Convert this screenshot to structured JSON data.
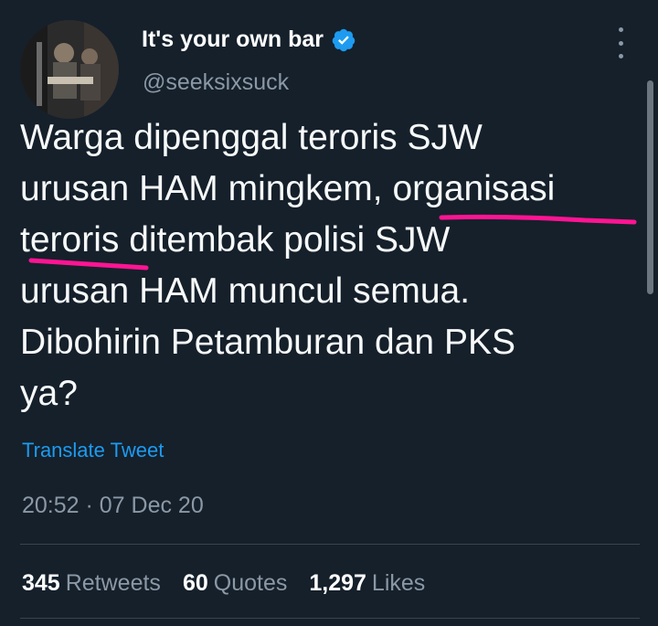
{
  "author": {
    "display_name": "It's your own bar",
    "handle": "@seeksixsuck"
  },
  "tweet": {
    "lines": [
      "Warga dipenggal teroris SJW",
      "urusan HAM mingkem, organisasi",
      "teroris ditembak polisi SJW",
      "urusan HAM muncul semua.",
      "Dibohirin Petamburan dan PKS",
      "ya?"
    ],
    "translate_label": "Translate Tweet",
    "timestamp": "20:52 · 07 Dec 20"
  },
  "stats": {
    "retweets_count": "345",
    "retweets_label": "Retweets",
    "quotes_count": "60",
    "quotes_label": "Quotes",
    "likes_count": "1,297",
    "likes_label": "Likes"
  },
  "colors": {
    "background": "#15202b",
    "accent": "#1d9bf0",
    "secondary_text": "#8b98a5",
    "annotation_underline": "#ff1493"
  },
  "icons": {
    "verified": "verified-badge-icon",
    "more": "more-options-icon"
  }
}
